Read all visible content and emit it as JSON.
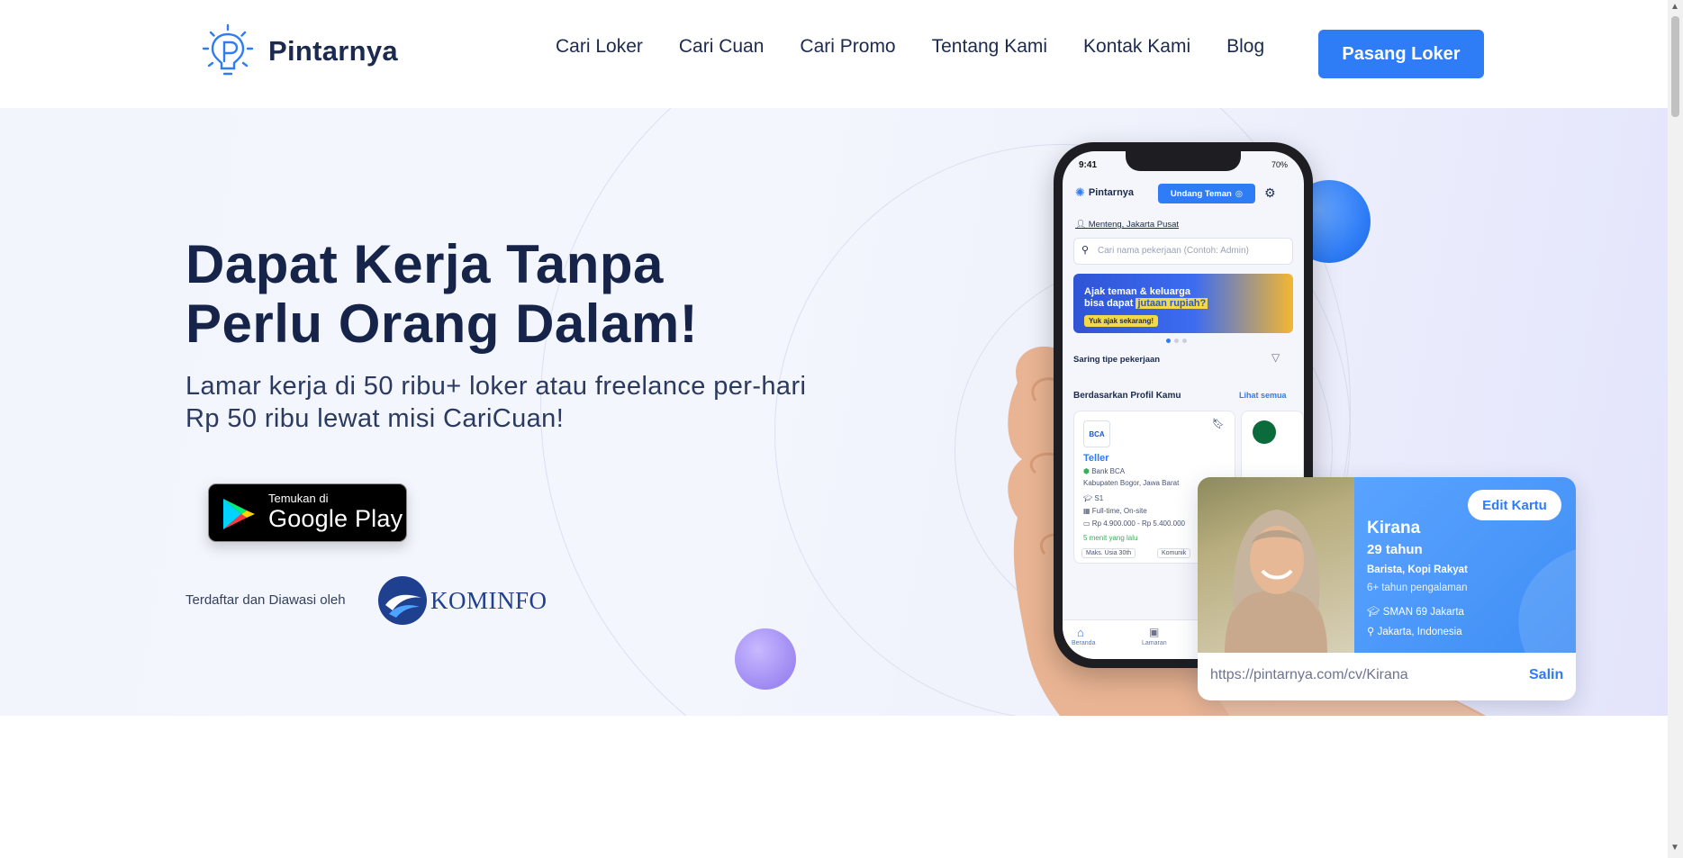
{
  "brand": {
    "name": "Pintarnya"
  },
  "nav": {
    "items": [
      "Cari Loker",
      "Cari Cuan",
      "Cari Promo",
      "Tentang Kami",
      "Kontak Kami",
      "Blog"
    ],
    "cta": "Pasang Loker"
  },
  "hero": {
    "title_line1": "Dapat Kerja Tanpa",
    "title_line2": "Perlu Orang Dalam!",
    "subtitle": "Lamar kerja di 50 ribu+ loker atau freelance per-hari Rp 50 ribu lewat misi CariCuan!",
    "store_badge": {
      "small": "Temukan di",
      "large": "Google Play"
    },
    "registered_text": "Terdaftar dan Diawasi oleh",
    "registrar": "KOMINFO"
  },
  "phone": {
    "time": "9:41",
    "battery": "70%",
    "app_name": "Pintarnya",
    "invite_button": "Undang Teman",
    "location": "Menteng, Jakarta Pusat",
    "search_placeholder": "Cari nama pekerjaan (Contoh: Admin)",
    "banner_line1": "Ajak teman & keluarga",
    "banner_line2_prefix": "bisa dapat ",
    "banner_highlight": "jutaan rupiah?",
    "banner_button": "Yuk ajak sekarang!",
    "filter_label": "Saring tipe pekerjaan",
    "section_title": "Berdasarkan Profil Kamu",
    "see_all": "Lihat semua",
    "job": {
      "logo": "BCA",
      "role": "Teller",
      "company": "Bank BCA",
      "location": "Kabupaten Bogor, Jawa Barat",
      "education": "S1",
      "type": "Full-time, On-site",
      "salary": "Rp 4.900.000 - Rp 5.400.000",
      "posted": "5 menit yang lalu",
      "tag1": "Maks. Usia 30th",
      "tag2": "Komunik"
    },
    "tabs": [
      "Beranda",
      "Lamaran"
    ]
  },
  "cv_card": {
    "edit_button": "Edit Kartu",
    "name": "Kirana",
    "age": "29 tahun",
    "job": "Barista, Kopi Rakyat",
    "experience": "6+ tahun pengalaman",
    "school": "SMAN 69 Jakarta",
    "city": "Jakarta, Indonesia",
    "url": "https://pintarnya.com/cv/Kirana",
    "copy_button": "Salin"
  },
  "colors": {
    "primary": "#2e7cf6",
    "heading": "#17244a",
    "hero_bg": "#f2f5fc",
    "orb_purple": "#a893f5"
  }
}
